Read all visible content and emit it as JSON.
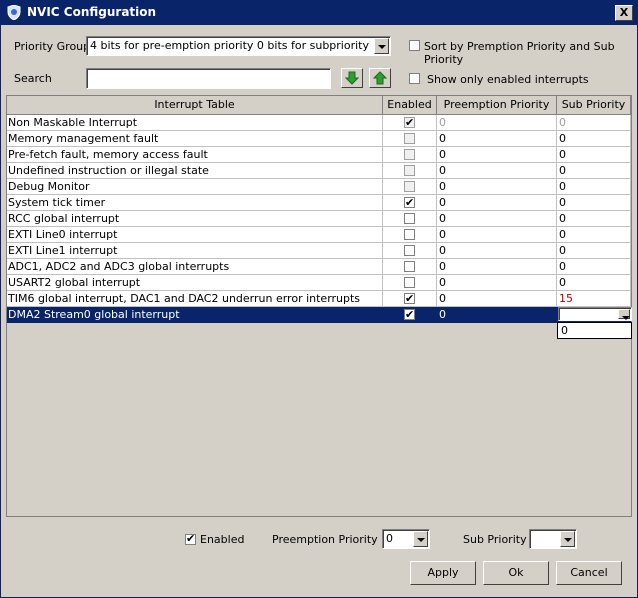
{
  "window": {
    "title": "NVIC Configuration",
    "close_glyph": "X"
  },
  "top": {
    "priority_group_label": "Priority Group",
    "priority_group_value": "4 bits for pre-emption priority 0 bits for subpriority",
    "sort_label": "Sort by Premption Priority and Sub Priority",
    "sort_checked": false,
    "search_label": "Search",
    "search_value": "",
    "show_enabled_label": "Show only enabled interrupts",
    "show_enabled_checked": false
  },
  "table": {
    "headers": [
      "Interrupt Table",
      "Enabled",
      "Preemption Priority",
      "Sub Priority"
    ],
    "rows": [
      {
        "name": "Non Maskable Interrupt",
        "enabled": true,
        "enabled_disabled": true,
        "preempt": "0",
        "sub": "0",
        "greyed": true
      },
      {
        "name": "Memory management fault",
        "enabled": false,
        "enabled_disabled": true,
        "preempt": "0",
        "sub": "0"
      },
      {
        "name": "Pre-fetch fault, memory access fault",
        "enabled": false,
        "enabled_disabled": true,
        "preempt": "0",
        "sub": "0"
      },
      {
        "name": "Undefined instruction or illegal state",
        "enabled": false,
        "enabled_disabled": true,
        "preempt": "0",
        "sub": "0"
      },
      {
        "name": "Debug Monitor",
        "enabled": false,
        "enabled_disabled": true,
        "preempt": "0",
        "sub": "0"
      },
      {
        "name": "System tick timer",
        "enabled": true,
        "enabled_disabled": false,
        "preempt": "0",
        "sub": "0"
      },
      {
        "name": "RCC global interrupt",
        "enabled": false,
        "enabled_disabled": false,
        "preempt": "0",
        "sub": "0"
      },
      {
        "name": "EXTI Line0 interrupt",
        "enabled": false,
        "enabled_disabled": false,
        "preempt": "0",
        "sub": "0"
      },
      {
        "name": "EXTI Line1 interrupt",
        "enabled": false,
        "enabled_disabled": false,
        "preempt": "0",
        "sub": "0"
      },
      {
        "name": "ADC1, ADC2 and ADC3 global interrupts",
        "enabled": false,
        "enabled_disabled": false,
        "preempt": "0",
        "sub": "0"
      },
      {
        "name": "USART2 global interrupt",
        "enabled": false,
        "enabled_disabled": false,
        "preempt": "0",
        "sub": "0"
      },
      {
        "name": "TIM6 global interrupt, DAC1 and DAC2 underrun error interrupts",
        "enabled": true,
        "enabled_disabled": false,
        "preempt": "0",
        "sub": "15",
        "sub_red": true
      },
      {
        "name": "DMA2 Stream0 global interrupt",
        "enabled": true,
        "enabled_disabled": false,
        "preempt": "0",
        "sub": "",
        "selected": true
      }
    ],
    "sub_dropdown_option": "0"
  },
  "bottom": {
    "enabled_label": "Enabled",
    "enabled_checked": true,
    "preemption_label": "Preemption Priority",
    "preemption_value": "0",
    "sub_label": "Sub Priority",
    "sub_value": ""
  },
  "buttons": {
    "apply": "Apply",
    "ok": "Ok",
    "cancel": "Cancel"
  },
  "colors": {
    "title_bar": "#0a246a",
    "selection": "#0a246a",
    "sub_red": "#c00000",
    "arrow_green": "#2e9e2e"
  }
}
